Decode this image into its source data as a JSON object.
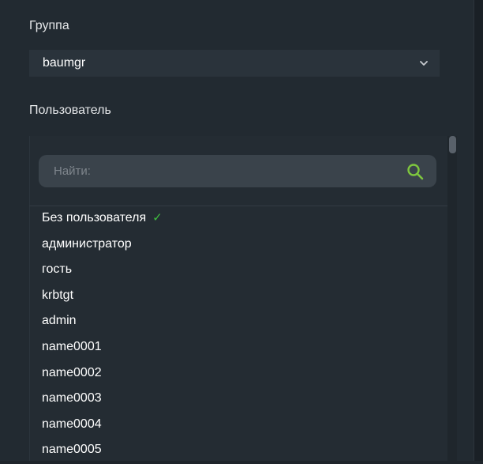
{
  "group": {
    "label": "Группа",
    "selected": "baumgr"
  },
  "user": {
    "label": "Пользователь",
    "search_placeholder": "Найти:",
    "items": [
      {
        "label": "Без пользователя",
        "checked": true
      },
      {
        "label": "администратор"
      },
      {
        "label": "гость"
      },
      {
        "label": "krbtgt"
      },
      {
        "label": "admin"
      },
      {
        "label": "name0001"
      },
      {
        "label": "name0002"
      },
      {
        "label": "name0003"
      },
      {
        "label": "name0004"
      },
      {
        "label": "name0005"
      }
    ],
    "check_mark": "✓"
  },
  "colors": {
    "accent_green": "#7ec63e",
    "check_green": "#3fbf3f",
    "background": "#222a31"
  },
  "icons": {
    "search": "search-icon",
    "chevron": "chevron-down-icon"
  }
}
